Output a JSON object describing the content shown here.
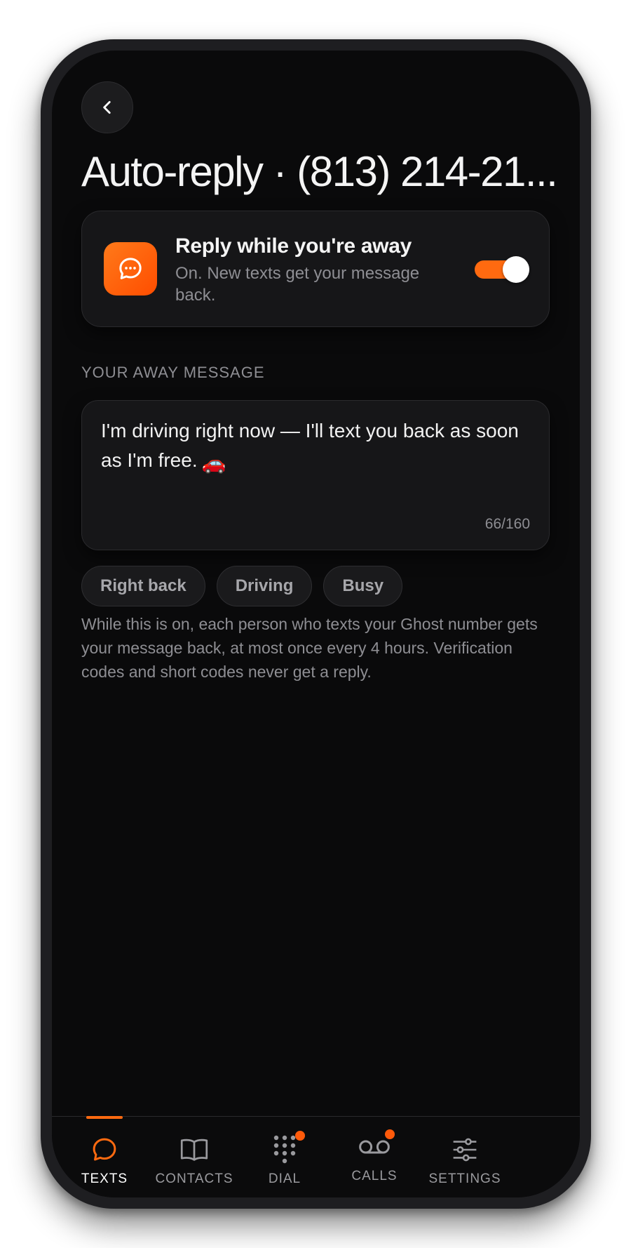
{
  "header": {
    "back_icon": "chevron-left-icon",
    "title": "Auto-reply · (813) 214-21..."
  },
  "toggle_card": {
    "icon": "chat-bubble-icon",
    "title": "Reply while you're away",
    "subtitle": "On. New texts get your message back.",
    "toggle_on": true,
    "accent": "#ff6a10"
  },
  "message": {
    "section_label": "YOUR AWAY MESSAGE",
    "text": "I'm driving right now — I'll text you back as soon as I'm free.",
    "emoji": "🚗",
    "counter": "66/160"
  },
  "presets": [
    {
      "label": "Right back"
    },
    {
      "label": "Driving"
    },
    {
      "label": "Busy"
    }
  ],
  "help_text": "While this is on, each person who texts your Ghost number gets your message back, at most once every 4 hours. Verification codes and short codes never get a reply.",
  "tabbar": {
    "tabs": [
      {
        "label": "TEXTS",
        "icon": "chat-bubble-icon",
        "active": true
      },
      {
        "label": "CONTACTS",
        "icon": "book-icon",
        "active": false
      },
      {
        "label": "DIAL",
        "icon": "keypad-icon",
        "active": false,
        "badge": true
      },
      {
        "label": "CALLS",
        "icon": "voicemail-icon",
        "active": false,
        "badge": true
      },
      {
        "label": "SETTINGS",
        "icon": "sliders-icon",
        "active": false
      }
    ]
  }
}
